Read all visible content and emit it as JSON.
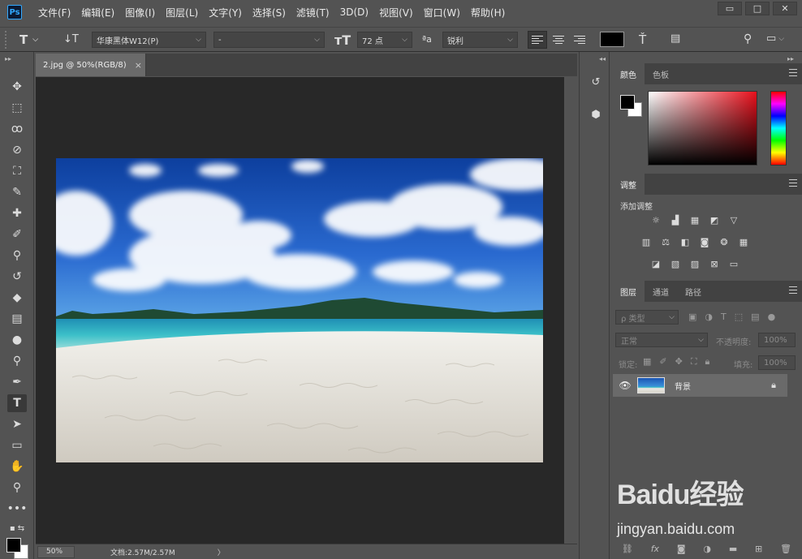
{
  "app": {
    "logo": "Ps"
  },
  "menu": [
    "文件(F)",
    "编辑(E)",
    "图像(I)",
    "图层(L)",
    "文字(Y)",
    "选择(S)",
    "滤镜(T)",
    "3D(D)",
    "视图(V)",
    "窗口(W)",
    "帮助(H)"
  ],
  "window_controls": {
    "minimize": "▭",
    "maximize": "□",
    "close": "✕"
  },
  "options": {
    "font_family": "华康黑体W12(P)",
    "font_style": "-",
    "font_size": "72 点",
    "aa_label": "ªa",
    "antialias": "锐利",
    "text_color": "#000000"
  },
  "document": {
    "tab_title": "2.jpg @ 50%(RGB/8)",
    "tab_close": "×",
    "zoom": "50%",
    "doc_info": "文档:2.57M/2.57M",
    "status_arrow": "〉"
  },
  "color_panel": {
    "tabs": [
      "颜色",
      "色板"
    ],
    "foreground": "#000000",
    "background": "#ffffff"
  },
  "adjust_panel": {
    "tab": "调整",
    "title": "添加调整"
  },
  "layers_panel": {
    "tabs": [
      "图层",
      "通道",
      "路径"
    ],
    "filter_kind": "ρ 类型",
    "blend_mode": "正常",
    "opacity_label": "不透明度:",
    "opacity_value": "100%",
    "lock_label": "锁定:",
    "fill_label": "填充:",
    "fill_value": "100%",
    "layer_name": "背景"
  },
  "watermark": {
    "brand": "Baidu经验",
    "url": "jingyan.baidu.com"
  }
}
